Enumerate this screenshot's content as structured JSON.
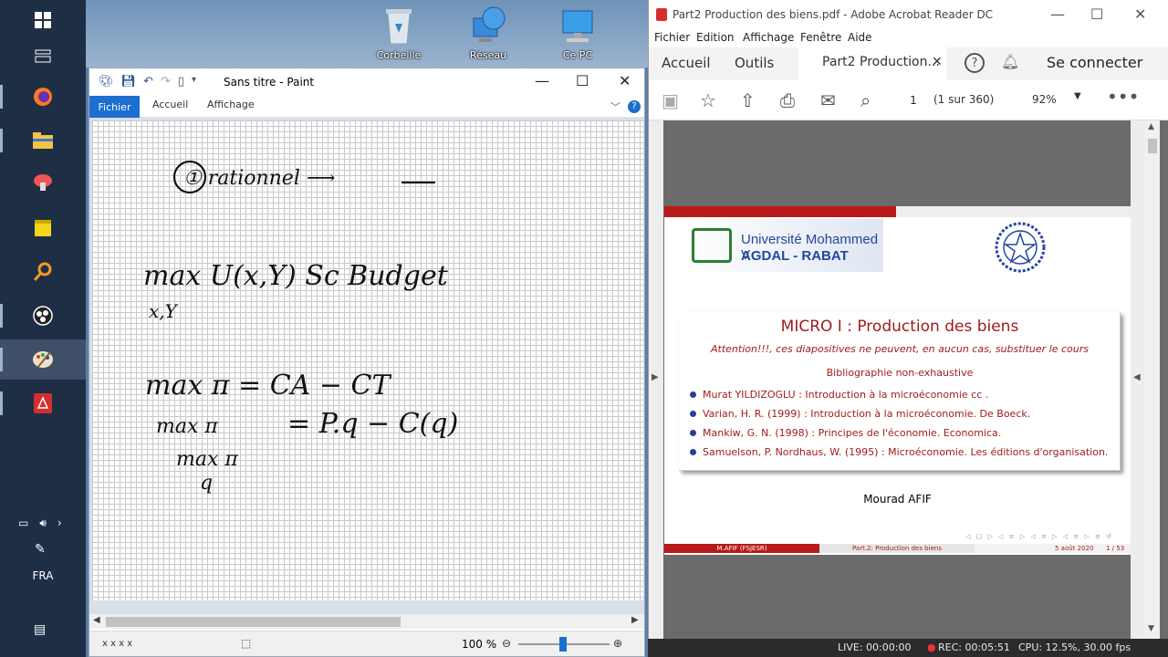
{
  "desktop": {
    "icons": [
      {
        "label": "Corbeille",
        "icon": "recycle-bin-icon"
      },
      {
        "label": "Réseau",
        "icon": "network-icon"
      },
      {
        "label": "Ce PC",
        "icon": "computer-icon"
      }
    ]
  },
  "taskbar": {
    "language": "FRA"
  },
  "paint": {
    "title": "Sans titre - Paint",
    "tabs": {
      "file": "Fichier",
      "home": "Accueil",
      "view": "Affichage"
    },
    "status": {
      "coords": "x  x  x  x",
      "zoom": "100 %"
    },
    "help": "?",
    "drawing": {
      "line1": "① rationnel ⟶",
      "line2": "max U(x,Y)   Sc Budget",
      "line2_sub": "x,Y",
      "line3": "max π = CA − CT",
      "line4": "= P.q − C(q)",
      "line4_prefix": "max π",
      "line5": "max π",
      "line5_sub": "q"
    }
  },
  "acrobat": {
    "title": "Part2 Production des biens.pdf - Adobe Acrobat Reader DC",
    "menu": [
      "Fichier",
      "Edition",
      "Affichage",
      "Fenêtre",
      "Aide"
    ],
    "tabs": {
      "home": "Accueil",
      "tools": "Outils",
      "doc": "Part2 Production..."
    },
    "help": "?",
    "connect": "Se connecter",
    "page_current": "1",
    "page_total": "(1 sur 360)",
    "zoom": "92%",
    "slide": {
      "logo_line1": "Université Mohammed V",
      "logo_line2": "AGDAL - RABAT",
      "title": "MICRO I : Production des biens",
      "warning": "Attention!!!, ces diapositives ne peuvent, en aucun cas, substituer le cours",
      "biblio_heading": "Bibliographie non-exhaustive",
      "references": [
        "Murat YILDIZOGLU : Introduction à la microéconomie  cc .",
        "Varian, H. R. (1999) : Introduction à la microéconomie. De Boeck.",
        "Mankiw, G. N. (1998) : Principes de l'économie. Economica.",
        "Samuelson, P. Nordhaus, W. (1995) : Microéconomie. Les éditions d'organisation."
      ],
      "author": "Mourad AFIF",
      "footer_left": "M.AFIF (FSJESR)",
      "footer_mid": "Part.2: Production des biens",
      "footer_date": "5 août 2020",
      "footer_page": "1 / 53"
    }
  },
  "obs": {
    "live": "LIVE: 00:00:00",
    "rec": "REC: 00:05:51",
    "cpu": "CPU: 12.5%, 30.00 fps"
  },
  "colors": {
    "slide_red": "#b81a1a",
    "paint_blue": "#1c6fcf",
    "taskbar": "#1e2e45"
  }
}
